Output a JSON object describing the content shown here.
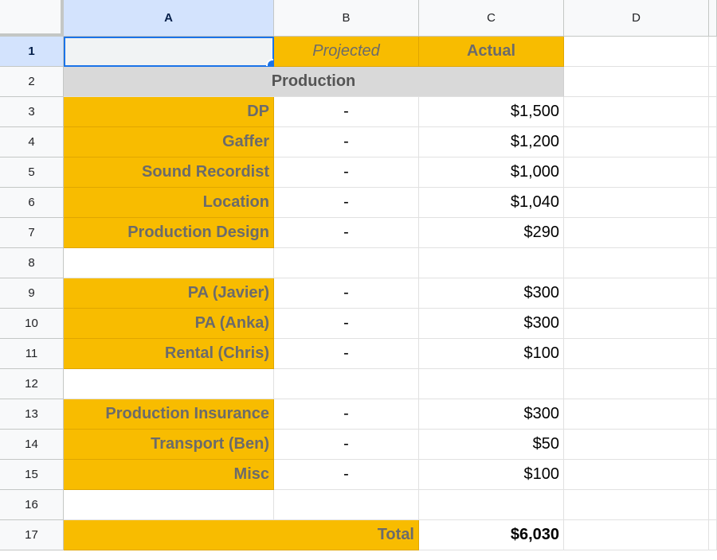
{
  "columns": [
    "A",
    "B",
    "C",
    "D"
  ],
  "rows": [
    "1",
    "2",
    "3",
    "4",
    "5",
    "6",
    "7",
    "8",
    "9",
    "10",
    "11",
    "12",
    "13",
    "14",
    "15",
    "16",
    "17"
  ],
  "header_row": {
    "b": "Projected",
    "c": "Actual"
  },
  "section_title": "Production",
  "line_items": [
    {
      "row": "3",
      "label": "DP",
      "projected": "-",
      "actual": "$1,500"
    },
    {
      "row": "4",
      "label": "Gaffer",
      "projected": "-",
      "actual": "$1,200"
    },
    {
      "row": "5",
      "label": "Sound Recordist",
      "projected": "-",
      "actual": "$1,000"
    },
    {
      "row": "6",
      "label": "Location",
      "projected": "-",
      "actual": "$1,040"
    },
    {
      "row": "7",
      "label": "Production Design",
      "projected": "-",
      "actual": "$290"
    },
    {
      "row": "9",
      "label": "PA (Javier)",
      "projected": "-",
      "actual": "$300"
    },
    {
      "row": "10",
      "label": "PA (Anka)",
      "projected": "-",
      "actual": "$300"
    },
    {
      "row": "11",
      "label": "Rental (Chris)",
      "projected": "-",
      "actual": "$100"
    },
    {
      "row": "13",
      "label": "Production Insurance",
      "projected": "-",
      "actual": "$300"
    },
    {
      "row": "14",
      "label": "Transport (Ben)",
      "projected": "-",
      "actual": "$50"
    },
    {
      "row": "15",
      "label": "Misc",
      "projected": "-",
      "actual": "$100"
    }
  ],
  "total": {
    "label": "Total",
    "value": "$6,030"
  },
  "selection": {
    "cell": "A1",
    "selected_column": "A",
    "selected_row": "1"
  },
  "colors": {
    "highlight_orange": "#f8bc00",
    "section_gray": "#d9d9d9",
    "selection_blue": "#1a73e8",
    "header_selected_bg": "#d3e3fd"
  }
}
